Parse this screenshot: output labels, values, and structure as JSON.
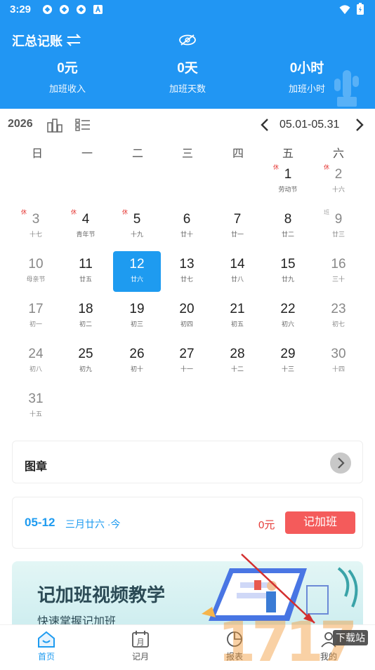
{
  "status": {
    "time": "3:29"
  },
  "summary": {
    "title": "汇总记账",
    "stats": [
      {
        "value": "0元",
        "label": "加班收入"
      },
      {
        "value": "0天",
        "label": "加班天数"
      },
      {
        "value": "0小时",
        "label": "加班小时"
      }
    ]
  },
  "calendar": {
    "year": "2026",
    "range": "05.01-05.31",
    "weekdays": [
      "日",
      "一",
      "二",
      "三",
      "四",
      "五",
      "六"
    ],
    "days": [
      {
        "n": "1",
        "l": "劳动节",
        "tag": "休"
      },
      {
        "n": "2",
        "l": "十六",
        "tag": "休"
      },
      {
        "n": "3",
        "l": "十七",
        "tag": "休"
      },
      {
        "n": "4",
        "l": "青年节",
        "tag": "休"
      },
      {
        "n": "5",
        "l": "十九",
        "tag": "休"
      },
      {
        "n": "6",
        "l": "廿十"
      },
      {
        "n": "7",
        "l": "廿一"
      },
      {
        "n": "8",
        "l": "廿二"
      },
      {
        "n": "9",
        "l": "廿三",
        "tag": "班"
      },
      {
        "n": "10",
        "l": "母亲节"
      },
      {
        "n": "11",
        "l": "廿五"
      },
      {
        "n": "12",
        "l": "廿六"
      },
      {
        "n": "13",
        "l": "廿七"
      },
      {
        "n": "14",
        "l": "廿八"
      },
      {
        "n": "15",
        "l": "廿九"
      },
      {
        "n": "16",
        "l": "三十"
      },
      {
        "n": "17",
        "l": "初一"
      },
      {
        "n": "18",
        "l": "初二"
      },
      {
        "n": "19",
        "l": "初三"
      },
      {
        "n": "20",
        "l": "初四"
      },
      {
        "n": "21",
        "l": "初五"
      },
      {
        "n": "22",
        "l": "初六"
      },
      {
        "n": "23",
        "l": "初七"
      },
      {
        "n": "24",
        "l": "初八"
      },
      {
        "n": "25",
        "l": "初九"
      },
      {
        "n": "26",
        "l": "初十"
      },
      {
        "n": "27",
        "l": "十一"
      },
      {
        "n": "28",
        "l": "十二"
      },
      {
        "n": "29",
        "l": "十三"
      },
      {
        "n": "30",
        "l": "十四"
      },
      {
        "n": "31",
        "l": "十五"
      }
    ],
    "selected": "12"
  },
  "seal": {
    "title": "图章"
  },
  "overtime": {
    "date": "05-12",
    "lunar": "三月廿六 ·今",
    "money": "0元",
    "button": "记加班"
  },
  "banner": {
    "title": "记加班视频教学",
    "subtitle": "快速掌握记加班"
  },
  "tabs": [
    {
      "label": "首页"
    },
    {
      "label": "记月"
    },
    {
      "label": "报表"
    },
    {
      "label": "我的"
    }
  ],
  "watermark": {
    "text": "下载站"
  },
  "colors": {
    "primary": "#2196f3",
    "accent": "#f45b5b",
    "holiday": "#e53935"
  }
}
